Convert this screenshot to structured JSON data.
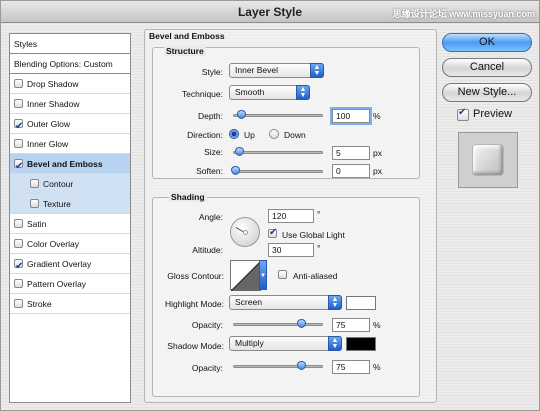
{
  "window": {
    "title": "Layer Style",
    "watermark": "思缘设计论坛 www.missyuan.com"
  },
  "styles_panel": {
    "header": "Styles",
    "blending": "Blending Options: Custom",
    "items": [
      {
        "label": "Drop Shadow",
        "checked": false
      },
      {
        "label": "Inner Shadow",
        "checked": false
      },
      {
        "label": "Outer Glow",
        "checked": true
      },
      {
        "label": "Inner Glow",
        "checked": false
      },
      {
        "label": "Bevel and Emboss",
        "checked": true
      },
      {
        "label": "Contour",
        "checked": false
      },
      {
        "label": "Texture",
        "checked": false
      },
      {
        "label": "Satin",
        "checked": false
      },
      {
        "label": "Color Overlay",
        "checked": false
      },
      {
        "label": "Gradient Overlay",
        "checked": true
      },
      {
        "label": "Pattern Overlay",
        "checked": false
      },
      {
        "label": "Stroke",
        "checked": false
      }
    ]
  },
  "bevel": {
    "title": "Bevel and Emboss",
    "structure": {
      "title": "Structure",
      "style_label": "Style:",
      "style_value": "Inner Bevel",
      "technique_label": "Technique:",
      "technique_value": "Smooth",
      "depth_label": "Depth:",
      "depth_value": "100",
      "depth_unit": "%",
      "direction_label": "Direction:",
      "direction_up": "Up",
      "direction_down": "Down",
      "size_label": "Size:",
      "size_value": "5",
      "size_unit": "px",
      "soften_label": "Soften:",
      "soften_value": "0",
      "soften_unit": "px"
    },
    "shading": {
      "title": "Shading",
      "angle_label": "Angle:",
      "angle_value": "120",
      "angle_unit": "°",
      "global_light": "Use Global Light",
      "altitude_label": "Altitude:",
      "altitude_value": "30",
      "altitude_unit": "°",
      "gloss_label": "Gloss Contour:",
      "anti_aliased": "Anti-aliased",
      "highlight_label": "Highlight Mode:",
      "highlight_value": "Screen",
      "highlight_opacity_label": "Opacity:",
      "highlight_opacity_value": "75",
      "highlight_opacity_unit": "%",
      "shadow_label": "Shadow Mode:",
      "shadow_value": "Multiply",
      "shadow_opacity_label": "Opacity:",
      "shadow_opacity_value": "75",
      "shadow_opacity_unit": "%",
      "highlight_color": "#ffffff",
      "shadow_color": "#000000"
    }
  },
  "buttons": {
    "ok": "OK",
    "cancel": "Cancel",
    "new_style": "New Style...",
    "preview": "Preview"
  }
}
